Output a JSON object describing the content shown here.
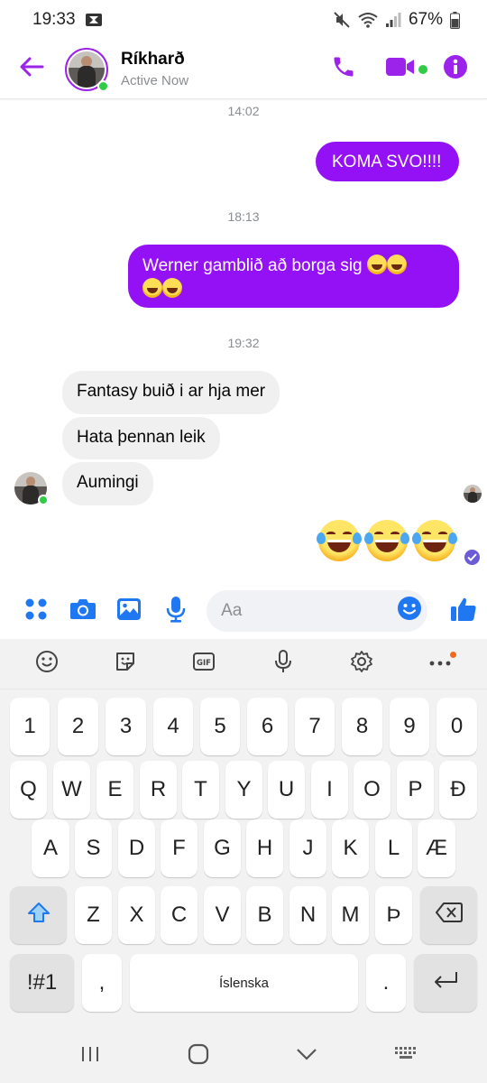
{
  "status_bar": {
    "time": "19:33",
    "battery": "67%"
  },
  "header": {
    "name": "Ríkharð",
    "status": "Active Now",
    "accent_color": "#9b23ea",
    "icons": [
      "back-arrow-icon",
      "phone-icon",
      "video-camera-icon",
      "info-icon"
    ]
  },
  "thread": {
    "timestamps": [
      "14:02",
      "18:13",
      "19:32"
    ],
    "outgoing": [
      {
        "text": "KOMA SVO!!!!"
      },
      {
        "line1": "Werner gamblið að borga sig",
        "emoji_count_line1": 2,
        "emoji_count_line2": 2
      }
    ],
    "incoming": [
      {
        "text": "Fantasy buið i ar hja mer"
      },
      {
        "text": "Hata þennan leik"
      },
      {
        "text": "Aumingi"
      }
    ],
    "reaction_emojis": [
      "rolling-on-floor-laughing",
      "rolling-on-floor-laughing",
      "rolling-on-floor-laughing"
    ],
    "outgoing_color": "#9411f6",
    "incoming_color": "#f0f0f0"
  },
  "composer": {
    "placeholder": "Aa",
    "icons": [
      "apps-icon",
      "camera-icon",
      "gallery-icon",
      "microphone-icon",
      "emoji-icon",
      "thumbs-up-icon"
    ],
    "icon_color": "#1f77f2"
  },
  "keyboard": {
    "toolbar": [
      "emoji-icon",
      "sticker-icon",
      "gif-icon",
      "microphone-icon",
      "settings-icon",
      "more-icon"
    ],
    "row1": [
      "1",
      "2",
      "3",
      "4",
      "5",
      "6",
      "7",
      "8",
      "9",
      "0"
    ],
    "row2": [
      "Q",
      "W",
      "E",
      "R",
      "T",
      "Y",
      "U",
      "I",
      "O",
      "P",
      "Ð"
    ],
    "row3": [
      "A",
      "S",
      "D",
      "F",
      "G",
      "H",
      "J",
      "K",
      "L",
      "Æ"
    ],
    "row4": [
      "Z",
      "X",
      "C",
      "V",
      "B",
      "N",
      "M",
      "Þ"
    ],
    "symbols_label": "!#1",
    "comma": ",",
    "space_label": "Íslenska",
    "period": "."
  },
  "nav_bar": {
    "icons": [
      "recent-apps-icon",
      "home-icon",
      "back-icon",
      "keyboard-hide-icon"
    ]
  }
}
